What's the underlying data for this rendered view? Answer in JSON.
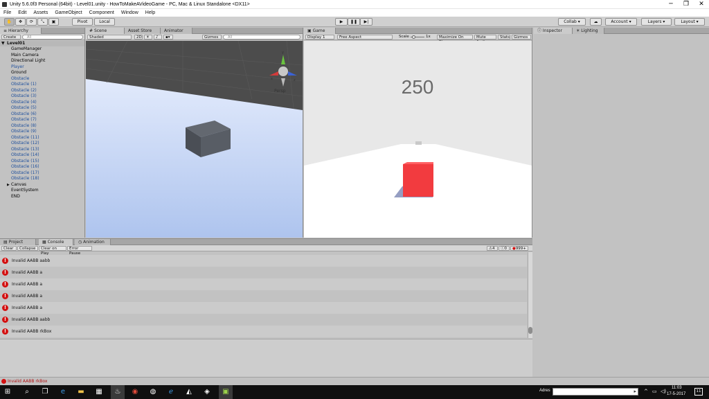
{
  "window": {
    "title": "Unity 5.6.0f3 Personal (64bit) - Level01.unity - HowToMakeAVideoGame - PC, Mac & Linux Standalone <DX11>",
    "controls": [
      "─",
      "❐",
      "✕"
    ]
  },
  "menu": [
    "File",
    "Edit",
    "Assets",
    "GameObject",
    "Component",
    "Window",
    "Help"
  ],
  "toolbar": {
    "pivot": "Pivot",
    "local": "Local",
    "collab": "Collab ▾",
    "account": "Account",
    "layers": "Layers",
    "layout": "Layout"
  },
  "hierarchy": {
    "tab": "Hierarchy",
    "create": "Create ▾",
    "search_placeholder": "All",
    "scene_name": "Level01",
    "items": [
      {
        "label": "GameManager",
        "prefab": false
      },
      {
        "label": "Main Camera",
        "prefab": false
      },
      {
        "label": "Directional Light",
        "prefab": false
      },
      {
        "label": "Player",
        "prefab": true
      },
      {
        "label": "Ground",
        "prefab": false
      },
      {
        "label": "Obstacle",
        "prefab": true
      },
      {
        "label": "Obstacle (1)",
        "prefab": true
      },
      {
        "label": "Obstacle (2)",
        "prefab": true
      },
      {
        "label": "Obstacle (3)",
        "prefab": true
      },
      {
        "label": "Obstacle (4)",
        "prefab": true
      },
      {
        "label": "Obstacle (5)",
        "prefab": true
      },
      {
        "label": "Obstacle (6)",
        "prefab": true
      },
      {
        "label": "Obstacle (7)",
        "prefab": true
      },
      {
        "label": "Obstacle (8)",
        "prefab": true
      },
      {
        "label": "Obstacle (9)",
        "prefab": true
      },
      {
        "label": "Obstacle (11)",
        "prefab": true
      },
      {
        "label": "Obstacle (12)",
        "prefab": true
      },
      {
        "label": "Obstacle (13)",
        "prefab": true
      },
      {
        "label": "Obstacle (14)",
        "prefab": true
      },
      {
        "label": "Obstacle (15)",
        "prefab": true
      },
      {
        "label": "Obstacle (16)",
        "prefab": true
      },
      {
        "label": "Obstacle (17)",
        "prefab": true
      },
      {
        "label": "Obstacle (18)",
        "prefab": true
      },
      {
        "label": "Canvas",
        "prefab": false
      },
      {
        "label": "EventSystem",
        "prefab": false
      },
      {
        "label": "END",
        "prefab": false
      }
    ]
  },
  "scene": {
    "tabs": [
      "Scene",
      "Asset Store",
      "Animator"
    ],
    "shading": "Shaded",
    "mode_2d": "2D",
    "gizmos": "Gizmos ▾",
    "search_placeholder": "All",
    "persp": "Persp"
  },
  "game": {
    "tab": "Game",
    "display": "Display 1",
    "aspect": "Free Aspect",
    "scale_label": "Scale",
    "scale_value": "1x",
    "maximize": "Maximize On Play",
    "mute": "Mute Audio",
    "stats": "Stats",
    "gizmos": "Gizmos ▾",
    "score": "250"
  },
  "inspector": {
    "tabs": [
      "Inspector",
      "Lighting"
    ]
  },
  "console": {
    "tabs": [
      "Project",
      "Console",
      "Animation"
    ],
    "buttons": [
      "Clear",
      "Collapse",
      "Clear on Play",
      "Error Pause"
    ],
    "warn_count": "4",
    "info_count": "0",
    "error_count": "999+",
    "rows": [
      "Invalid AABB aabb",
      "Invalid AABB a",
      "Invalid AABB a",
      "Invalid AABB a",
      "Invalid AABB a",
      "Invalid AABB aabb",
      "Invalid AABB rkBox"
    ]
  },
  "statusbar": {
    "message": "Invalid AABB rkBox"
  },
  "taskbar": {
    "address_label": "Adres",
    "time": "11:03",
    "date": "17-5-2017",
    "notif_count": "11"
  },
  "colors": {
    "error_red": "#d31111",
    "cube_red": "#f23b3f",
    "prefab_blue": "#1e4f9c"
  }
}
